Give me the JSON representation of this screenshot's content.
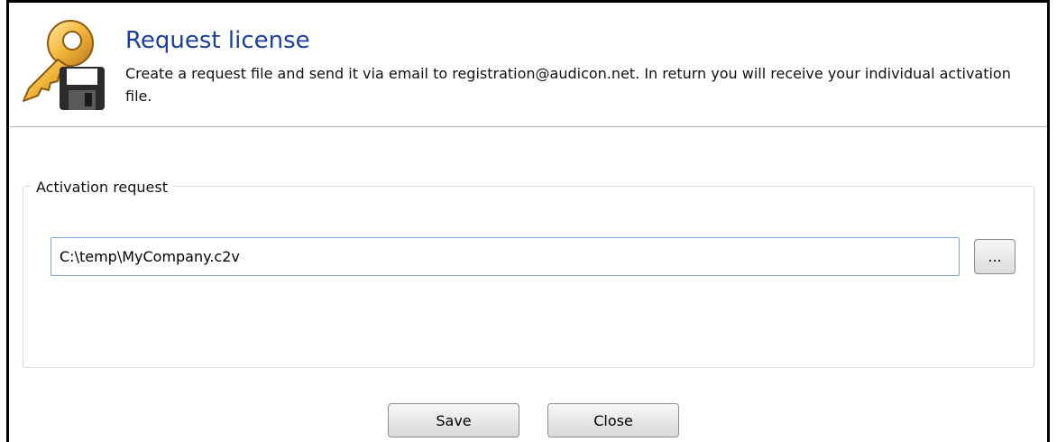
{
  "header": {
    "title": "Request license",
    "description": "Create a request file and send it via email to registration@audicon.net. In return you will receive your individual activation file.",
    "icon": "key-floppy-icon"
  },
  "activation_group": {
    "legend": "Activation request",
    "path_value": "C:\\temp\\MyCompany.c2v",
    "browse_label": "..."
  },
  "footer": {
    "save_label": "Save",
    "close_label": "Close"
  },
  "colors": {
    "title": "#1c3f9a",
    "separator": "#b9b3a8",
    "input_border": "#7aa6d6"
  }
}
